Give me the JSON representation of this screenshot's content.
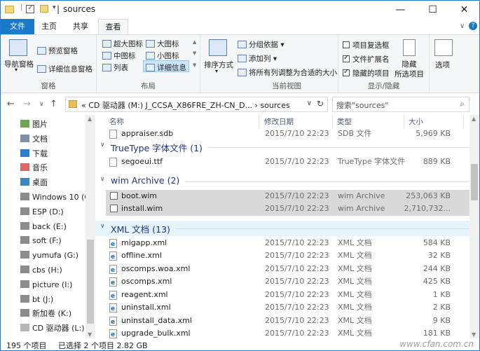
{
  "window": {
    "title": "sources",
    "controls": {
      "minimize": "—",
      "maximize": "☐",
      "close": "✕"
    }
  },
  "ribbon_tabs": [
    "文件",
    "主页",
    "共享",
    "查看"
  ],
  "ribbon_tabs_right": {
    "chevron": "∨",
    "help": "?"
  },
  "ribbon": {
    "pane_group": {
      "label": "窗格",
      "nav_pane": "导航窗格",
      "preview": "预览窗格",
      "details": "详细信息窗格"
    },
    "layout_group": {
      "label": "布局",
      "xlarge": "超大图标",
      "large": "大图标",
      "medium": "中图标",
      "small": "小图标",
      "list": "列表",
      "details": "详细信息"
    },
    "sort_label": "排序方式",
    "view_group": {
      "label": "当前视图",
      "group_by": "分组依据",
      "add_col": "添加列",
      "fit_cols": "将所有列调整为合适的大小"
    },
    "show_group": {
      "label": "显示/隐藏",
      "item_check": "项目复选框",
      "ext": "文件扩展名",
      "hidden": "隐藏的项目",
      "hide_sel": "隐藏\n所选项目"
    },
    "options": "选项"
  },
  "nav": {
    "back": "←",
    "forward": "→",
    "recent": "∨",
    "up": "↑",
    "address_path": "«  CD 驱动器 (M:) J_CCSA_X86FRE_ZH-CN_D...  ›  sources",
    "search_placeholder": "搜索\"sources\""
  },
  "nav_pane": [
    {
      "label": "图片",
      "icon": "pictures-icon"
    },
    {
      "label": "文档",
      "icon": "documents-icon"
    },
    {
      "label": "下载",
      "icon": "downloads-icon"
    },
    {
      "label": "音乐",
      "icon": "music-icon"
    },
    {
      "label": "桌面",
      "icon": "desktop-icon"
    },
    {
      "label": "Windows 10 (C",
      "icon": "drive-icon"
    },
    {
      "label": "ESP (D:)",
      "icon": "drive-icon"
    },
    {
      "label": "back (E:)",
      "icon": "drive-icon"
    },
    {
      "label": "soft (F:)",
      "icon": "drive-icon"
    },
    {
      "label": "yumufa (G:)",
      "icon": "drive-icon"
    },
    {
      "label": "cbs (H:)",
      "icon": "drive-icon"
    },
    {
      "label": "picture (I:)",
      "icon": "drive-icon"
    },
    {
      "label": "bt (J:)",
      "icon": "drive-icon"
    },
    {
      "label": "新加卷 (K:)",
      "icon": "drive-icon"
    },
    {
      "label": "CD 驱动器 (L:) W",
      "icon": "cd-drive-icon"
    }
  ],
  "columns": {
    "name": "名称",
    "date": "修改日期",
    "type": "类型",
    "size": "大小"
  },
  "partial_row": {
    "name": "appraiser.sdb",
    "date": "2015/7/10 22:23",
    "type": "SDB 文件",
    "size": "5,969 KB"
  },
  "groups": [
    {
      "title": "TrueType 字体文件 (1)",
      "files": [
        {
          "name": "segoeui.ttf",
          "date": "2015/7/10 22:23",
          "type": "TrueType 字体文件",
          "size": "889 KB",
          "icon": "font",
          "selected": false
        }
      ]
    },
    {
      "title": "wim Archive (2)",
      "files": [
        {
          "name": "boot.wim",
          "date": "2015/7/10 22:23",
          "type": "wim Archive",
          "size": "253,063 KB",
          "icon": "wim",
          "selected": true
        },
        {
          "name": "install.wim",
          "date": "2015/7/10 22:23",
          "type": "wim Archive",
          "size": "2,710,732...",
          "icon": "wim",
          "selected": true
        }
      ]
    },
    {
      "title": "XML 文档 (13)",
      "files": [
        {
          "name": "migapp.xml",
          "date": "2015/7/10 22:23",
          "type": "XML 文档",
          "size": "584 KB",
          "icon": "xml",
          "selected": false
        },
        {
          "name": "offline.xml",
          "date": "2015/7/10 22:23",
          "type": "XML 文档",
          "size": "32 KB",
          "icon": "xml",
          "selected": false
        },
        {
          "name": "oscomps.woa.xml",
          "date": "2015/7/10 22:23",
          "type": "XML 文档",
          "size": "244 KB",
          "icon": "xml",
          "selected": false
        },
        {
          "name": "oscomps.xml",
          "date": "2015/7/10 22:23",
          "type": "XML 文档",
          "size": "425 KB",
          "icon": "xml",
          "selected": false
        },
        {
          "name": "reagent.xml",
          "date": "2015/7/10 22:23",
          "type": "XML 文档",
          "size": "1 KB",
          "icon": "xml",
          "selected": false
        },
        {
          "name": "uninstall.xml",
          "date": "2015/7/10 22:23",
          "type": "XML 文档",
          "size": "2 KB",
          "icon": "xml",
          "selected": false
        },
        {
          "name": "uninstall_data.xml",
          "date": "2015/7/10 22:23",
          "type": "XML 文档",
          "size": "9 KB",
          "icon": "xml",
          "selected": false
        },
        {
          "name": "upgrade_bulk.xml",
          "date": "2015/7/10 22:23",
          "type": "XML 文档",
          "size": "181 KB",
          "icon": "xml",
          "selected": false
        }
      ]
    }
  ],
  "status": {
    "count": "195 个项目",
    "selected": "已选择 2 个项目  2.82 GB"
  },
  "watermark": "www.cfan.com.cn",
  "colors": {
    "accent": "#1979ca",
    "selection": "#d9d9d9",
    "group_title": "#1e3287"
  }
}
